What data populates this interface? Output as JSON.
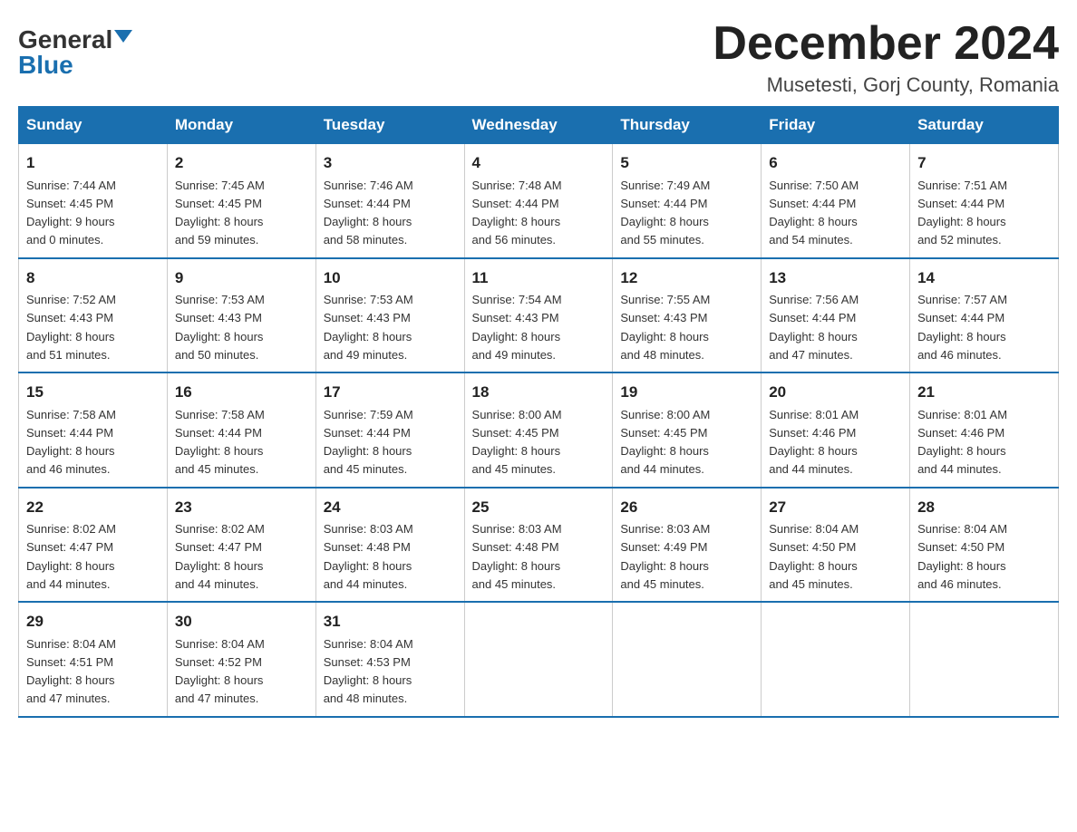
{
  "header": {
    "logo_general": "General",
    "logo_blue": "Blue",
    "month_title": "December 2024",
    "location": "Musetesti, Gorj County, Romania"
  },
  "weekdays": [
    "Sunday",
    "Monday",
    "Tuesday",
    "Wednesday",
    "Thursday",
    "Friday",
    "Saturday"
  ],
  "weeks": [
    [
      {
        "day": "1",
        "sunrise": "7:44 AM",
        "sunset": "4:45 PM",
        "daylight": "9 hours and 0 minutes."
      },
      {
        "day": "2",
        "sunrise": "7:45 AM",
        "sunset": "4:45 PM",
        "daylight": "8 hours and 59 minutes."
      },
      {
        "day": "3",
        "sunrise": "7:46 AM",
        "sunset": "4:44 PM",
        "daylight": "8 hours and 58 minutes."
      },
      {
        "day": "4",
        "sunrise": "7:48 AM",
        "sunset": "4:44 PM",
        "daylight": "8 hours and 56 minutes."
      },
      {
        "day": "5",
        "sunrise": "7:49 AM",
        "sunset": "4:44 PM",
        "daylight": "8 hours and 55 minutes."
      },
      {
        "day": "6",
        "sunrise": "7:50 AM",
        "sunset": "4:44 PM",
        "daylight": "8 hours and 54 minutes."
      },
      {
        "day": "7",
        "sunrise": "7:51 AM",
        "sunset": "4:44 PM",
        "daylight": "8 hours and 52 minutes."
      }
    ],
    [
      {
        "day": "8",
        "sunrise": "7:52 AM",
        "sunset": "4:43 PM",
        "daylight": "8 hours and 51 minutes."
      },
      {
        "day": "9",
        "sunrise": "7:53 AM",
        "sunset": "4:43 PM",
        "daylight": "8 hours and 50 minutes."
      },
      {
        "day": "10",
        "sunrise": "7:53 AM",
        "sunset": "4:43 PM",
        "daylight": "8 hours and 49 minutes."
      },
      {
        "day": "11",
        "sunrise": "7:54 AM",
        "sunset": "4:43 PM",
        "daylight": "8 hours and 49 minutes."
      },
      {
        "day": "12",
        "sunrise": "7:55 AM",
        "sunset": "4:43 PM",
        "daylight": "8 hours and 48 minutes."
      },
      {
        "day": "13",
        "sunrise": "7:56 AM",
        "sunset": "4:44 PM",
        "daylight": "8 hours and 47 minutes."
      },
      {
        "day": "14",
        "sunrise": "7:57 AM",
        "sunset": "4:44 PM",
        "daylight": "8 hours and 46 minutes."
      }
    ],
    [
      {
        "day": "15",
        "sunrise": "7:58 AM",
        "sunset": "4:44 PM",
        "daylight": "8 hours and 46 minutes."
      },
      {
        "day": "16",
        "sunrise": "7:58 AM",
        "sunset": "4:44 PM",
        "daylight": "8 hours and 45 minutes."
      },
      {
        "day": "17",
        "sunrise": "7:59 AM",
        "sunset": "4:44 PM",
        "daylight": "8 hours and 45 minutes."
      },
      {
        "day": "18",
        "sunrise": "8:00 AM",
        "sunset": "4:45 PM",
        "daylight": "8 hours and 45 minutes."
      },
      {
        "day": "19",
        "sunrise": "8:00 AM",
        "sunset": "4:45 PM",
        "daylight": "8 hours and 44 minutes."
      },
      {
        "day": "20",
        "sunrise": "8:01 AM",
        "sunset": "4:46 PM",
        "daylight": "8 hours and 44 minutes."
      },
      {
        "day": "21",
        "sunrise": "8:01 AM",
        "sunset": "4:46 PM",
        "daylight": "8 hours and 44 minutes."
      }
    ],
    [
      {
        "day": "22",
        "sunrise": "8:02 AM",
        "sunset": "4:47 PM",
        "daylight": "8 hours and 44 minutes."
      },
      {
        "day": "23",
        "sunrise": "8:02 AM",
        "sunset": "4:47 PM",
        "daylight": "8 hours and 44 minutes."
      },
      {
        "day": "24",
        "sunrise": "8:03 AM",
        "sunset": "4:48 PM",
        "daylight": "8 hours and 44 minutes."
      },
      {
        "day": "25",
        "sunrise": "8:03 AM",
        "sunset": "4:48 PM",
        "daylight": "8 hours and 45 minutes."
      },
      {
        "day": "26",
        "sunrise": "8:03 AM",
        "sunset": "4:49 PM",
        "daylight": "8 hours and 45 minutes."
      },
      {
        "day": "27",
        "sunrise": "8:04 AM",
        "sunset": "4:50 PM",
        "daylight": "8 hours and 45 minutes."
      },
      {
        "day": "28",
        "sunrise": "8:04 AM",
        "sunset": "4:50 PM",
        "daylight": "8 hours and 46 minutes."
      }
    ],
    [
      {
        "day": "29",
        "sunrise": "8:04 AM",
        "sunset": "4:51 PM",
        "daylight": "8 hours and 47 minutes."
      },
      {
        "day": "30",
        "sunrise": "8:04 AM",
        "sunset": "4:52 PM",
        "daylight": "8 hours and 47 minutes."
      },
      {
        "day": "31",
        "sunrise": "8:04 AM",
        "sunset": "4:53 PM",
        "daylight": "8 hours and 48 minutes."
      },
      null,
      null,
      null,
      null
    ]
  ]
}
